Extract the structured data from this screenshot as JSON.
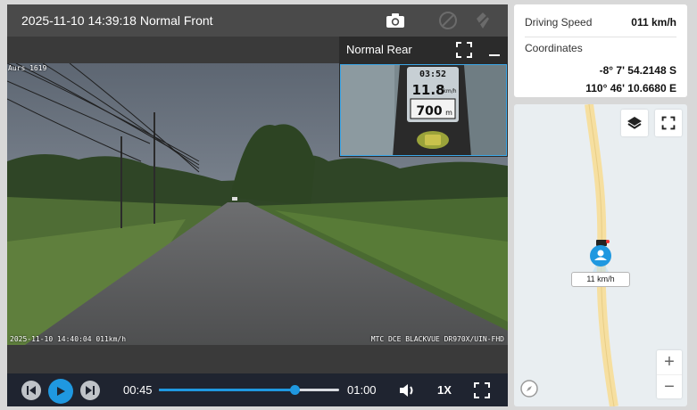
{
  "video": {
    "title": "2025-11-10 14:39:18 Normal Front",
    "osd_top": "Aurs 1619",
    "osd_timestamp": "2025-11-10 14:40:04 011km/h",
    "osd_brand": "MTC DCE BLACKVUE DR970X/UIN-FHD"
  },
  "rear": {
    "title": "Normal Rear",
    "gps_readouts": [
      "03:52",
      "11.8",
      "km/h",
      "700",
      "m"
    ]
  },
  "playback": {
    "current_time": "00:45",
    "total_time": "01:00",
    "progress_fraction": 0.75,
    "speed": "1X"
  },
  "info": {
    "speed_label": "Driving Speed",
    "speed_value": "011 km/h",
    "coords_label": "Coordinates",
    "latitude": "-8° 7' 54.2148 S",
    "longitude": "110° 46' 10.6680 E"
  },
  "map": {
    "speed_tag": "11 km/h",
    "zoom_in": "+",
    "zoom_out": "−"
  },
  "colors": {
    "accent": "#1f98e0",
    "road": "#f6dfa0",
    "map_bg": "#e9eef1",
    "playbar": "#1f2430"
  },
  "icons": [
    "camera-icon",
    "sound-off-icon",
    "gps-off-icon",
    "fullscreen-icon",
    "minimize-icon",
    "prev-icon",
    "play-icon",
    "next-icon",
    "volume-icon",
    "layers-icon",
    "compass-icon",
    "vehicle-icon"
  ]
}
